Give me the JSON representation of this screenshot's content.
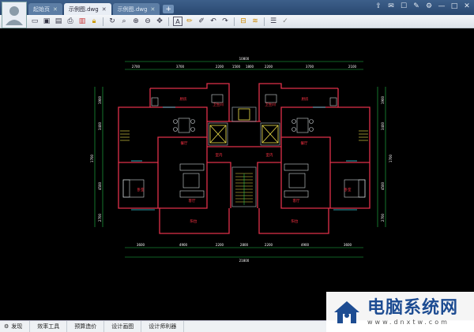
{
  "tabs": [
    {
      "label": "起始页",
      "active": false
    },
    {
      "label": "示例图.dwg",
      "active": true
    },
    {
      "label": "示例图.dwg",
      "active": false
    }
  ],
  "tab_add_label": "+",
  "window_controls": [
    "share-icon",
    "chat-icon",
    "phone-icon",
    "pin-icon",
    "gear-icon",
    "minimize-icon",
    "maximize-icon",
    "close-icon"
  ],
  "toolbar_icons": [
    "open-icon",
    "save-icon",
    "save-as-icon",
    "print-icon",
    "pdf-icon",
    "lock-icon",
    "rotate-icon",
    "zoom-window-icon",
    "zoom-in-icon",
    "zoom-out-icon",
    "pan-icon",
    "text-icon",
    "pencil-icon",
    "brush-icon",
    "undo-icon",
    "redo-icon",
    "measure-icon",
    "layer-icon",
    "layers-icon",
    "check-icon"
  ],
  "floorplan": {
    "total_width_label": "10800",
    "total_bottom_label": "21800",
    "top_dims": [
      "2700",
      "3700",
      "2200",
      "1500",
      "1800",
      "2200",
      "3700",
      "2100"
    ],
    "bottom_dims": [
      "3600",
      "4900",
      "2200",
      "2800",
      "2200",
      "4900",
      "3600"
    ],
    "left_dims": [
      "1900",
      "3400",
      "1700",
      "4500",
      "2700"
    ],
    "right_dims": [
      "1900",
      "3400",
      "1700",
      "4500",
      "2700"
    ],
    "rooms": [
      {
        "label": "厨房"
      },
      {
        "label": "卫生间"
      },
      {
        "label": "厨房"
      },
      {
        "label": "卫生间"
      },
      {
        "label": "餐厅"
      },
      {
        "label": "餐厅"
      },
      {
        "label": "客厅"
      },
      {
        "label": "客厅"
      },
      {
        "label": "卧室"
      },
      {
        "label": "卧室"
      },
      {
        "label": "阳台"
      },
      {
        "label": "阳台"
      },
      {
        "label": "室内"
      },
      {
        "label": "室内"
      }
    ]
  },
  "status": {
    "items": [
      {
        "icon": "gear-icon",
        "label": "发现"
      },
      {
        "icon": "",
        "label": "效率工具"
      },
      {
        "icon": "",
        "label": "预算造价"
      },
      {
        "icon": "",
        "label": "设计画图"
      },
      {
        "icon": "",
        "label": "设计师利器"
      }
    ]
  },
  "watermark": {
    "title": "电脑系统网",
    "url": "www.dnxtw.com"
  },
  "colors": {
    "titlebar": "#2a4870",
    "wall": "#e0304a",
    "dimension": "#22c24a",
    "text": "#ffffff",
    "furniture": "#cfd4d8",
    "stairs": "#f0e14a",
    "room_label": "#ff3344"
  }
}
